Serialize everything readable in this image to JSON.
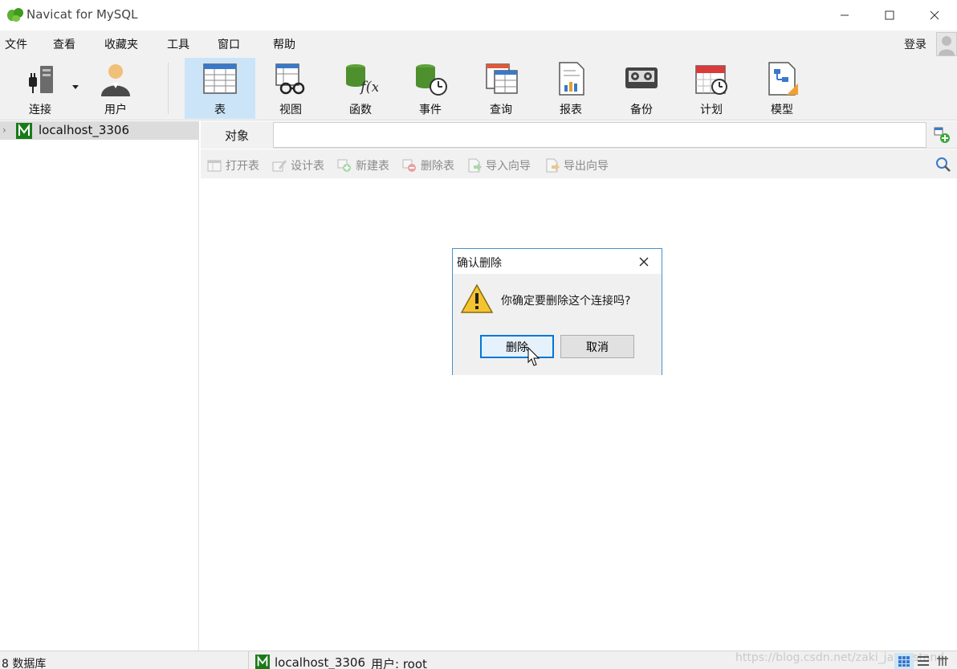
{
  "window": {
    "title": "Navicat for MySQL"
  },
  "menu": {
    "items": [
      "文件",
      "查看",
      "收藏夹",
      "工具",
      "窗口",
      "帮助"
    ],
    "login": "登录"
  },
  "toolbar": {
    "items": [
      {
        "label": "连接",
        "icon": "plug-icon"
      },
      {
        "label": "用户",
        "icon": "user-icon"
      },
      {
        "label": "表",
        "icon": "table-icon",
        "active": true
      },
      {
        "label": "视图",
        "icon": "view-icon"
      },
      {
        "label": "函数",
        "icon": "function-icon"
      },
      {
        "label": "事件",
        "icon": "event-icon"
      },
      {
        "label": "查询",
        "icon": "query-icon"
      },
      {
        "label": "报表",
        "icon": "report-icon"
      },
      {
        "label": "备份",
        "icon": "backup-icon"
      },
      {
        "label": "计划",
        "icon": "schedule-icon"
      },
      {
        "label": "模型",
        "icon": "model-icon"
      }
    ]
  },
  "nav": {
    "connections": [
      {
        "label": "localhost_3306"
      }
    ]
  },
  "tabs": {
    "object_label": "对象"
  },
  "object_toolbar": {
    "buttons": [
      {
        "label": "打开表",
        "icon": "open-table-icon"
      },
      {
        "label": "设计表",
        "icon": "design-table-icon"
      },
      {
        "label": "新建表",
        "icon": "new-table-icon"
      },
      {
        "label": "删除表",
        "icon": "delete-table-icon"
      },
      {
        "label": "导入向导",
        "icon": "import-wizard-icon"
      },
      {
        "label": "导出向导",
        "icon": "export-wizard-icon"
      }
    ]
  },
  "dialog": {
    "title": "确认删除",
    "message": "你确定要删除这个连接吗?",
    "confirm_label": "删除",
    "cancel_label": "取消"
  },
  "status": {
    "db_count": "8 数据库",
    "connection": "localhost_3306",
    "user": "用户: root",
    "watermark": "https://blog.csdn.net/zaki_java_stand"
  },
  "colors": {
    "accent": "#0078d7",
    "active_tool": "#cce4f7",
    "dialog_border": "#4a90c8"
  }
}
